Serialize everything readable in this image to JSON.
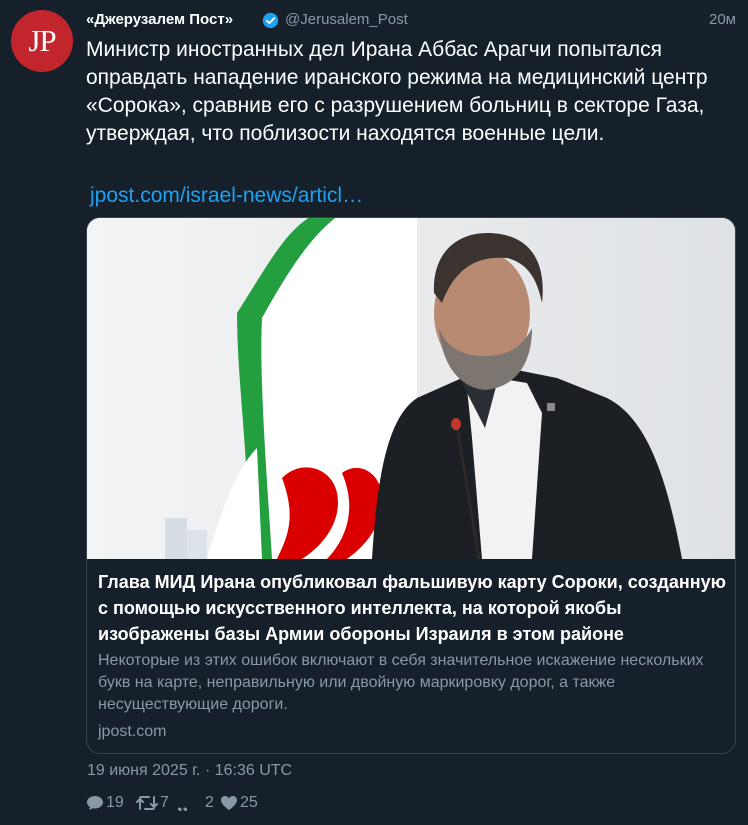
{
  "account": {
    "avatar_text": "JP",
    "name": "«Джерузалем Пост»",
    "handle": "@Jerusalem_Post",
    "time": "20м"
  },
  "tweet": {
    "text": "Министр иностранных дел Ирана Аббас Арагчи попытался оправдать нападение иранского режима на медицинский центр «Сорока», сравнив его с разрушением больниц в секторе Газа, утверждая, что поблизости находятся военные цели.",
    "link": "jpost.com/israel-news/articl…",
    "date": "19 июня 2025 г. · 16:36 UTC"
  },
  "card": {
    "title": "Глава МИД Ирана опубликовал фальшивую карту Сороки, созданную с помощью искусственного интеллекта, на которой якобы изображены базы Армии обороны Израиля в этом районе",
    "description": "Некоторые из этих ошибок включают в себя значительное искажение нескольких букв на карте, неправильную или двойную маркировку дорог, а также несуществующие дороги.",
    "domain": "jpost.com"
  },
  "stats": {
    "replies": "19",
    "retweets": "7",
    "quotes": "2",
    "likes": "25"
  },
  "colors": {
    "background": "#15202b",
    "accent": "#1da1f2",
    "muted": "#8899a6",
    "avatar": "#c2262c"
  },
  "icons": [
    "verified-badge-icon",
    "reply-icon",
    "retweet-icon",
    "quote-icon",
    "heart-icon"
  ]
}
